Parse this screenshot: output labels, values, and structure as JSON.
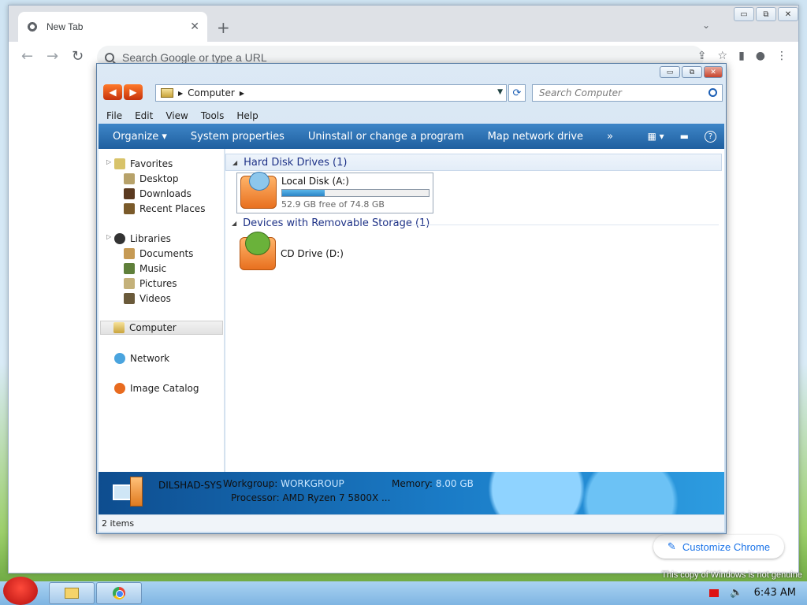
{
  "chrome": {
    "tab_title": "New Tab",
    "tab_close": "✕",
    "new_tab": "+",
    "tabs_menu": "⌄",
    "omnibox_placeholder": "Search Google or type a URL",
    "customize_label": "Customize Chrome",
    "window_controls": [
      "▭",
      "⧉",
      "✕"
    ]
  },
  "explorer": {
    "window_controls": [
      "▭",
      "⧉",
      "✕"
    ],
    "nav_buttons": [
      "◀",
      "▶"
    ],
    "address": {
      "segment": "Computer"
    },
    "search_placeholder": "Search Computer",
    "menu": [
      "File",
      "Edit",
      "View",
      "Tools",
      "Help"
    ],
    "commands": [
      "Organize ▾",
      "System properties",
      "Uninstall or change a program",
      "Map network drive",
      "»"
    ],
    "help": "?",
    "nav": {
      "favorites": "Favorites",
      "favorites_items": [
        "Desktop",
        "Downloads",
        "Recent Places"
      ],
      "libraries": "Libraries",
      "libraries_items": [
        "Documents",
        "Music",
        "Pictures",
        "Videos"
      ],
      "computer": "Computer",
      "network": "Network",
      "image_catalog": "Image Catalog"
    },
    "groups": {
      "hdd": "Hard Disk Drives (1)",
      "removable": "Devices with Removable Storage (1)"
    },
    "drives": [
      {
        "name": "Local Disk (A:)",
        "free": "52.9 GB free of 74.8 GB",
        "used_fraction": 0.29
      },
      {
        "name": "CD Drive (D:)"
      }
    ],
    "details": {
      "computer_name": "DILSHAD-SYS",
      "workgroup_label": "Workgroup:",
      "workgroup_value": "WORKGROUP",
      "memory_label": "Memory:",
      "memory_value": "8.00 GB",
      "processor_label": "Processor:",
      "processor_value": "AMD Ryzen 7 5800X ..."
    },
    "status": "2 items"
  },
  "taskbar": {
    "clock": "6:43 AM",
    "genuine": "This copy of Windows is not genuine"
  }
}
